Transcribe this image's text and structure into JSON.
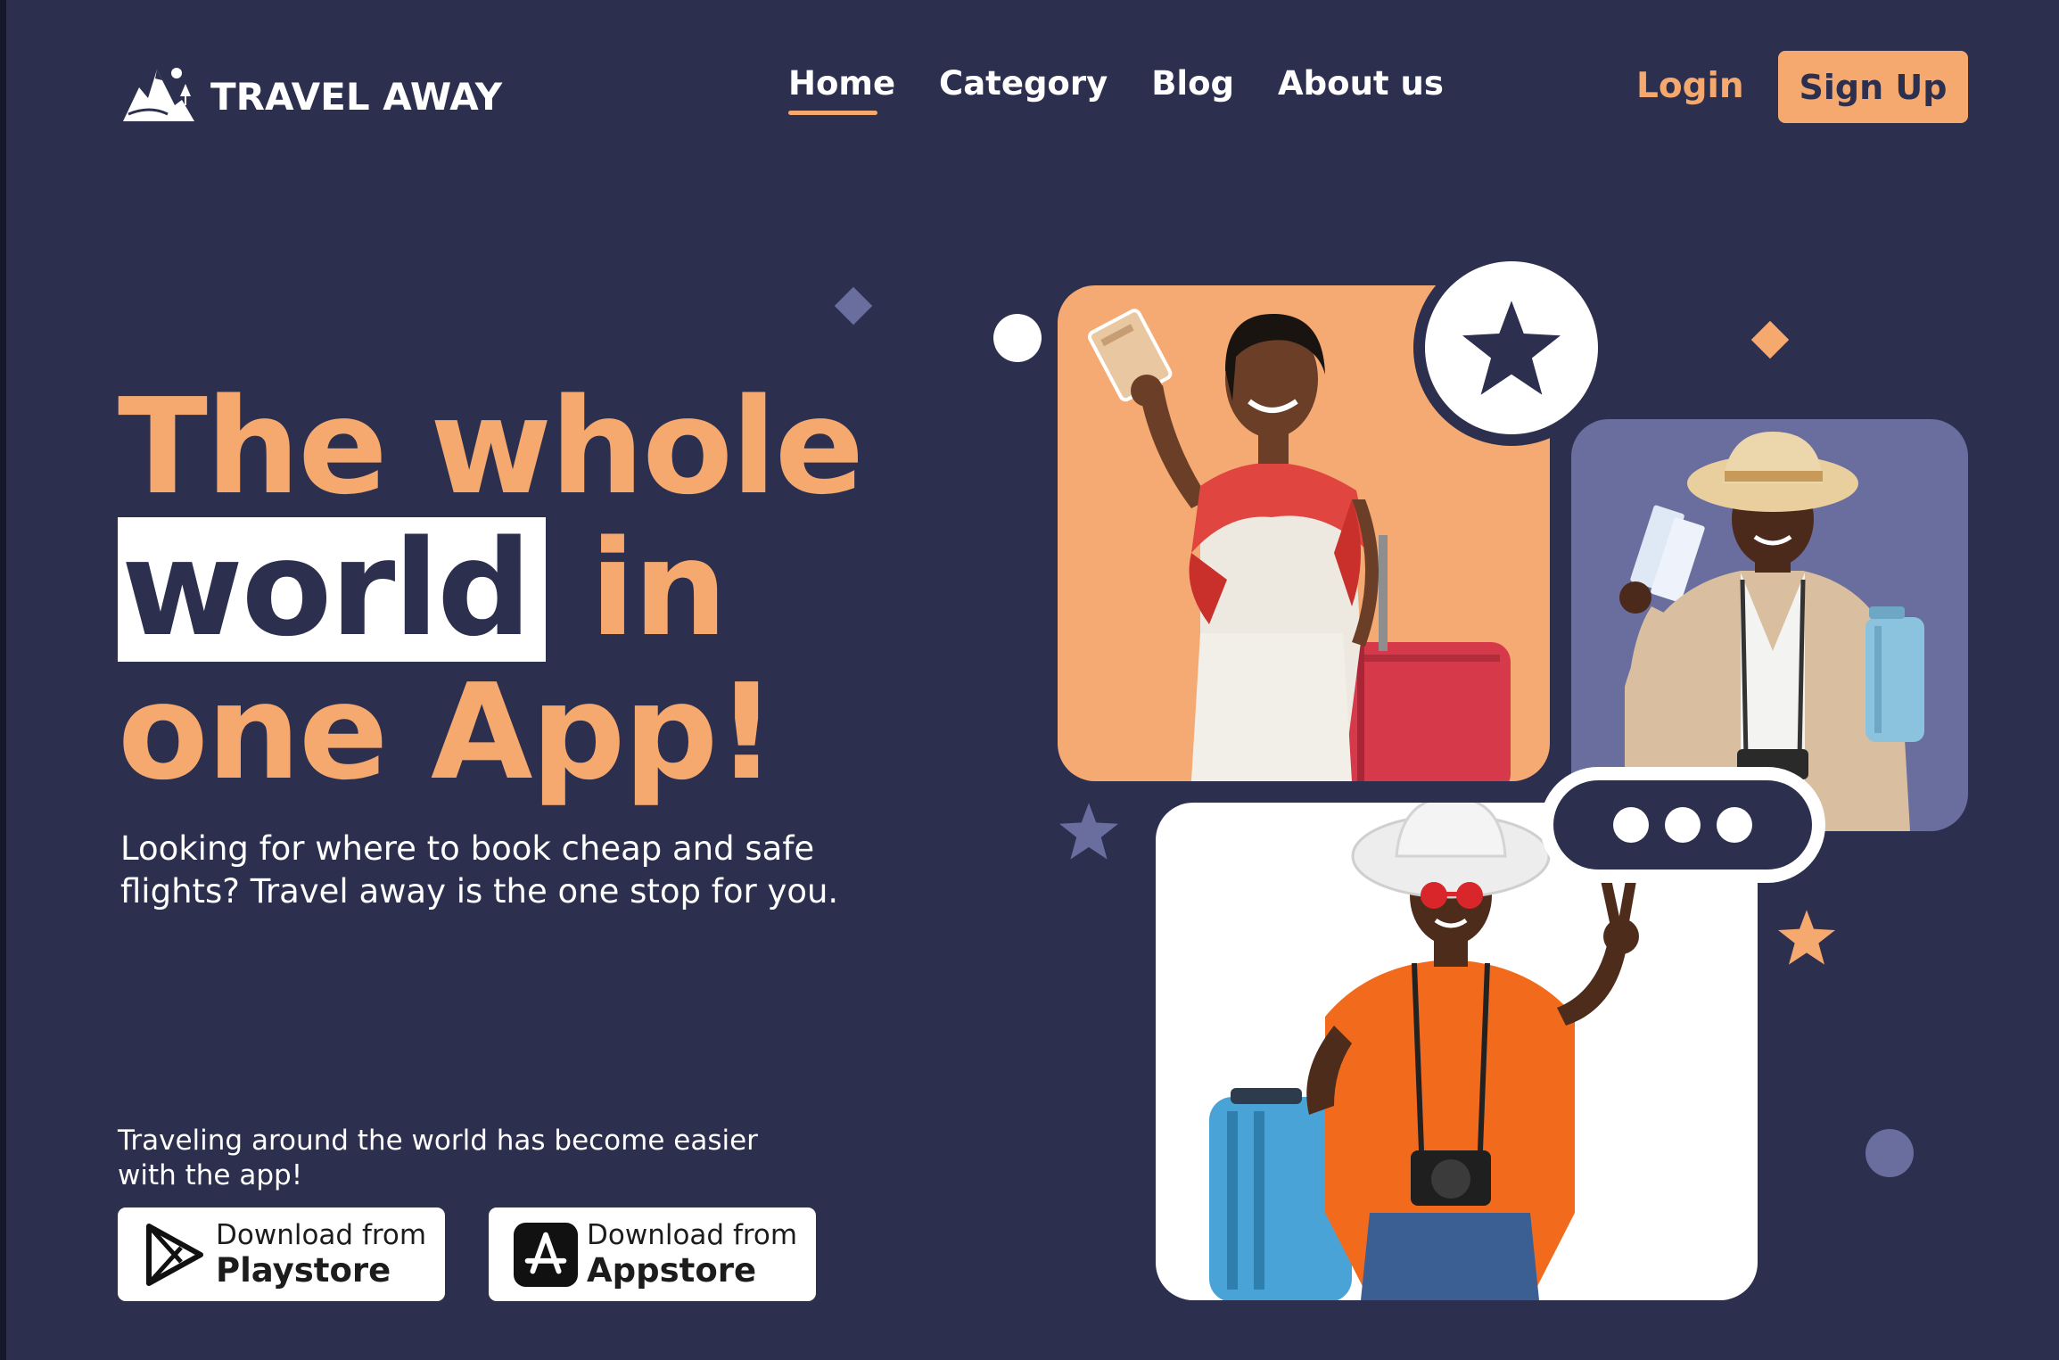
{
  "brand": {
    "name": "TRAVEL AWAY"
  },
  "nav": {
    "items": [
      {
        "label": "Home",
        "active": true
      },
      {
        "label": "Category",
        "active": false
      },
      {
        "label": "Blog",
        "active": false
      },
      {
        "label": "About us",
        "active": false
      }
    ],
    "login_label": "Login",
    "signup_label": "Sign Up"
  },
  "hero": {
    "headline_line1": "The whole",
    "headline_highlight": "world",
    "headline_line2_rest": "in",
    "headline_line3": "one App!",
    "subtitle": "Looking for where to book cheap and safe flights? Travel away is the one stop for you.",
    "tagline": "Traveling around the world has become easier with the app!"
  },
  "downloads": {
    "playstore": {
      "small": "Download from",
      "big": "Playstore"
    },
    "appstore": {
      "small": "Download from",
      "big": "Appstore"
    }
  },
  "colors": {
    "background": "#2c2f4e",
    "accent": "#f6a96e",
    "purple": "#6a6e9e",
    "white": "#ffffff"
  },
  "icons": [
    "mountain-logo-icon",
    "star-icon",
    "playstore-icon",
    "appstore-icon",
    "more-dots-icon"
  ]
}
